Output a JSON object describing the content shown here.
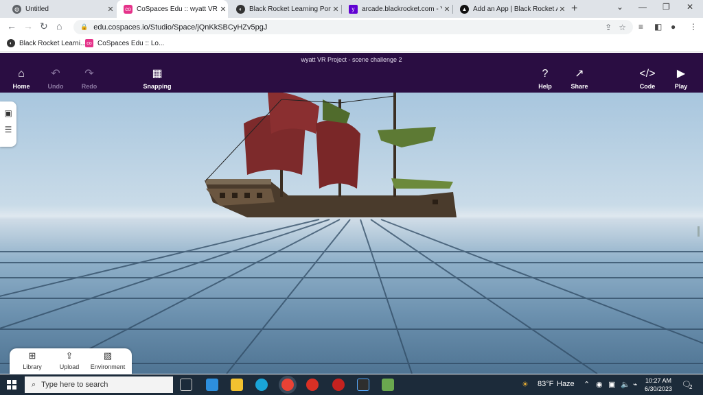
{
  "browser": {
    "tabs": [
      {
        "title": "Untitled",
        "favicon": "globe-icon",
        "color": "#5f6368",
        "active": false
      },
      {
        "title": "CoSpaces Edu :: wyatt VR Pro",
        "favicon": "cospaces-logo-icon",
        "color": "#e5338a",
        "active": true
      },
      {
        "title": "Black Rocket Learning Portal",
        "favicon": "blackrocket-icon",
        "color": "#333333",
        "active": false
      },
      {
        "title": "arcade.blackrocket.com - Yah",
        "favicon": "yahoo-icon",
        "color": "#6001d2",
        "active": false
      },
      {
        "title": "Add an App | Black Rocket A",
        "favicon": "rocket-icon",
        "color": "#111111",
        "active": false
      }
    ],
    "url": "edu.cospaces.io/Studio/Space/jQnKkSBCyHZv5pgJ",
    "bookmarks": [
      {
        "label": "Black Rocket Learni...",
        "favicon": "blackrocket-icon",
        "color": "#333333"
      },
      {
        "label": "CoSpaces Edu :: Lo...",
        "favicon": "cospaces-logo-icon",
        "color": "#e5338a"
      }
    ]
  },
  "app": {
    "title": "wyatt VR Project - scene challenge 2",
    "header_color": "#2a0d42",
    "left_buttons": [
      {
        "label": "Home",
        "icon": "home-icon",
        "enabled": true
      },
      {
        "label": "Undo",
        "icon": "undo-icon",
        "enabled": false
      },
      {
        "label": "Redo",
        "icon": "redo-icon",
        "enabled": false
      },
      {
        "label": "Snapping",
        "icon": "snapping-grid-icon",
        "enabled": true
      }
    ],
    "right_buttons": [
      {
        "label": "Help",
        "icon": "help-icon"
      },
      {
        "label": "Share",
        "icon": "share-icon"
      },
      {
        "label": "Code",
        "icon": "code-icon"
      },
      {
        "label": "Play",
        "icon": "play-icon"
      }
    ],
    "side_panel": [
      {
        "icon": "gallery-icon"
      },
      {
        "icon": "list-icon"
      }
    ],
    "bottom_panel": [
      {
        "label": "Library",
        "icon": "library-icon"
      },
      {
        "label": "Upload",
        "icon": "upload-icon"
      },
      {
        "label": "Environment",
        "icon": "environment-icon"
      }
    ]
  },
  "taskbar": {
    "search_placeholder": "Type here to search",
    "weather": {
      "temp": "83°F",
      "condition": "Haze"
    },
    "time": "10:27 AM",
    "date": "6/30/2023",
    "notification_count": "2",
    "apps": [
      {
        "icon": "task-view-icon",
        "color": "#ffffff"
      },
      {
        "icon": "weather-widget-icon",
        "color": "#2d8fdd"
      },
      {
        "icon": "file-explorer-icon",
        "color": "#f2c230"
      },
      {
        "icon": "edge-icon",
        "color": "#1aa5d8"
      },
      {
        "icon": "chrome-icon",
        "color": "#e94235"
      },
      {
        "icon": "chrome-red-icon",
        "color": "#d93025"
      },
      {
        "icon": "chrome-red-2-icon",
        "color": "#c5221f"
      },
      {
        "icon": "terminal-icon",
        "color": "#2e2e2e"
      },
      {
        "icon": "minecraft-icon",
        "color": "#6aa84f"
      }
    ]
  }
}
